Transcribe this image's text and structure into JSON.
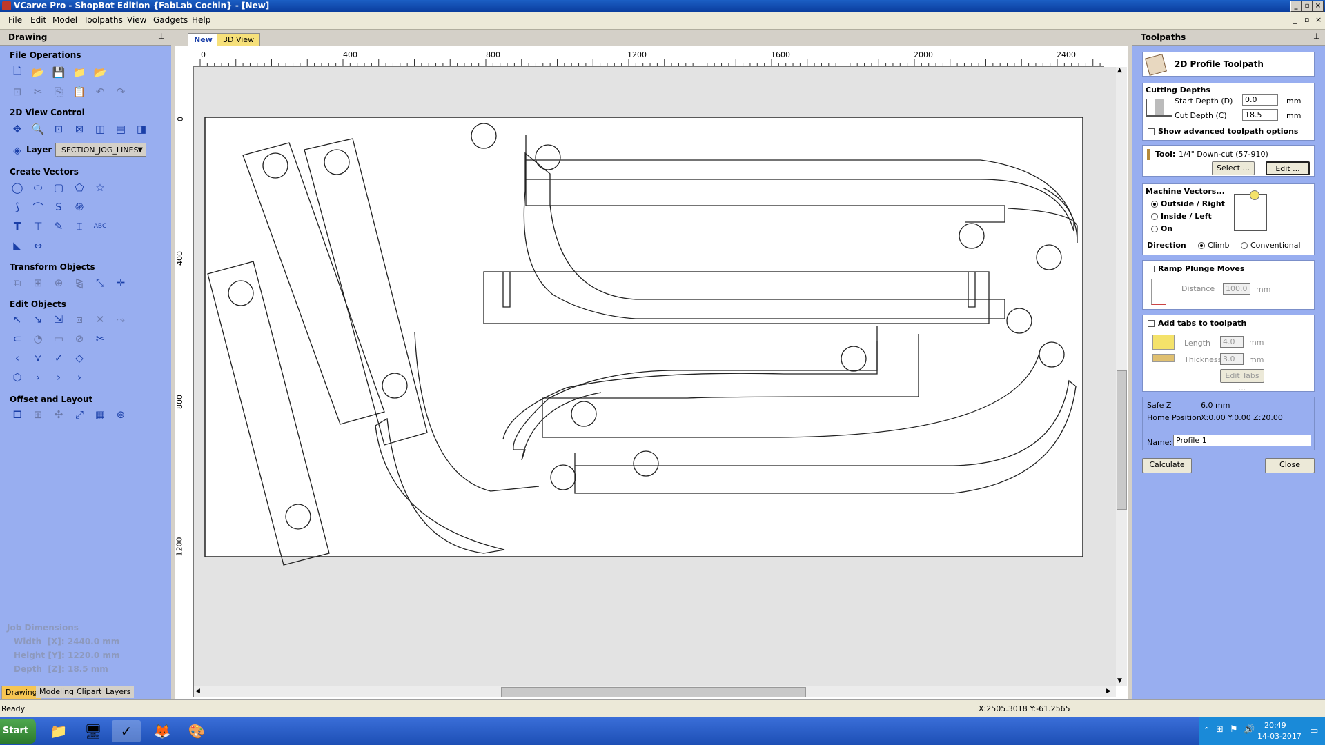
{
  "window": {
    "title": "VCarve Pro - ShopBot Edition {FabLab Cochin} - [New]"
  },
  "menu": [
    "File",
    "Edit",
    "Model",
    "Toolpaths",
    "View",
    "Gadgets",
    "Help"
  ],
  "left_panel": {
    "title": "Drawing",
    "sections": {
      "file_ops": "File Operations",
      "view_control": "2D View Control",
      "layer_label": "Layer",
      "layer_value": "SECTION_JOG_LINES",
      "create_vectors": "Create Vectors",
      "transform": "Transform Objects",
      "edit": "Edit Objects",
      "offset": "Offset and Layout"
    },
    "job": {
      "title": "Job Dimensions",
      "width": "Width  [X]: 2440.0 mm",
      "height": "Height [Y]: 1220.0 mm",
      "depth": "Depth  [Z]: 18.5 mm"
    },
    "tabs": [
      "Drawing",
      "Modeling",
      "Clipart",
      "Layers"
    ]
  },
  "doc_tabs": [
    "New",
    "3D View"
  ],
  "ruler": {
    "top_labels": [
      "0",
      "400",
      "800",
      "1200",
      "1600",
      "2000",
      "2400"
    ],
    "left_labels": [
      "0",
      "400",
      "800",
      "1200"
    ]
  },
  "right_panel": {
    "title": "Toolpaths",
    "toolpath_name": "2D Profile Toolpath",
    "cutting_depths": "Cutting Depths",
    "start_depth_label": "Start Depth (D)",
    "start_depth": "0.0",
    "cut_depth_label": "Cut Depth (C)",
    "cut_depth": "18.5",
    "unit": "mm",
    "advanced": "Show advanced toolpath options",
    "tool_label": "Tool:",
    "tool_value": "1/4\" Down-cut (57-910)",
    "select_btn": "Select ...",
    "edit_btn": "Edit ...",
    "machine_vectors": "Machine Vectors...",
    "outside": "Outside / Right",
    "inside": "Inside / Left",
    "on": "On",
    "direction": "Direction",
    "climb": "Climb",
    "conventional": "Conventional",
    "ramp": "Ramp Plunge Moves",
    "distance_label": "Distance",
    "distance": "100.0",
    "tabs": "Add tabs to toolpath",
    "length_label": "Length",
    "length": "4.0",
    "thickness_label": "Thickness",
    "thickness": "3.0",
    "edit_tabs": "Edit Tabs ...",
    "safe_z_label": "Safe Z",
    "safe_z": "6.0 mm",
    "home_label": "Home Position",
    "home": "X:0.00 Y:0.00 Z:20.00",
    "name_label": "Name:",
    "name_value": "Profile 1",
    "calculate": "Calculate",
    "close": "Close"
  },
  "status": {
    "text": "Ready",
    "coords": "X:2505.3018 Y:-61.2565"
  },
  "taskbar": {
    "start": "Start",
    "time": "20:49",
    "date": "14-03-2017"
  }
}
